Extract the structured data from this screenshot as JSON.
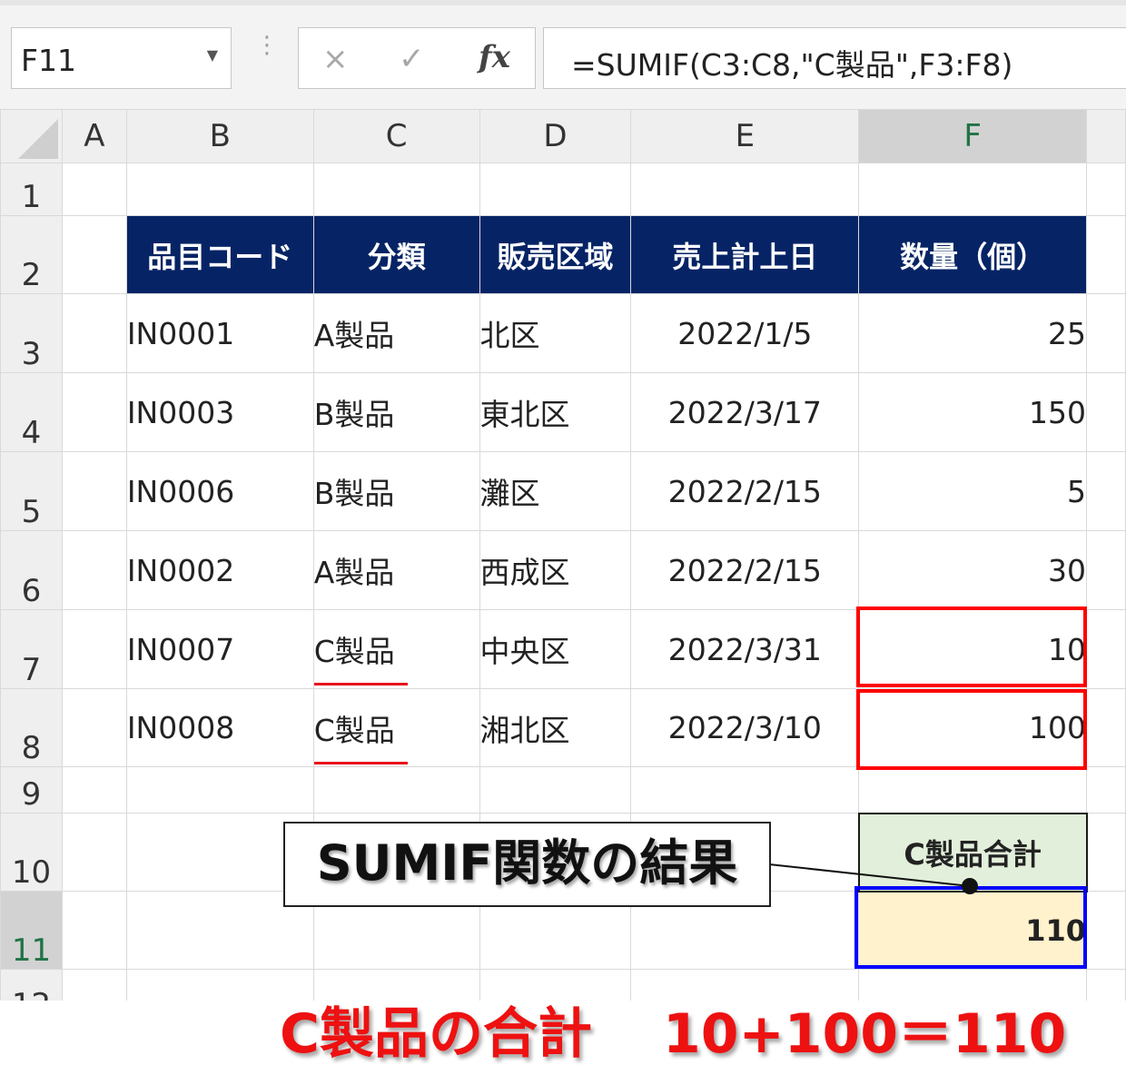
{
  "formula_bar": {
    "name_box": "F11",
    "cancel_icon": "×",
    "enter_icon": "✓",
    "fx_label": "fx",
    "formula": "=SUMIF(C3:C8,\"C製品\",F3:F8)"
  },
  "columns": [
    "A",
    "B",
    "C",
    "D",
    "E",
    "F"
  ],
  "rows": [
    "1",
    "2",
    "3",
    "4",
    "5",
    "6",
    "7",
    "8",
    "9",
    "10",
    "11",
    "12"
  ],
  "selected_cell": "F11",
  "table": {
    "headers": [
      "品目コード",
      "分類",
      "販売区域",
      "売上計上日",
      "数量（個）"
    ],
    "rows": [
      [
        "IN0001",
        "A製品",
        "北区",
        "2022/1/5",
        "25"
      ],
      [
        "IN0003",
        "B製品",
        "東北区",
        "2022/3/17",
        "150"
      ],
      [
        "IN0006",
        "B製品",
        "灘区",
        "2022/2/15",
        "5"
      ],
      [
        "IN0002",
        "A製品",
        "西成区",
        "2022/2/15",
        "30"
      ],
      [
        "IN0007",
        "C製品",
        "中央区",
        "2022/3/31",
        "10"
      ],
      [
        "IN0008",
        "C製品",
        "湘北区",
        "2022/3/10",
        "100"
      ]
    ]
  },
  "summary": {
    "label": "C製品合計",
    "value": "110"
  },
  "callout": "SUMIF関数の結果",
  "caption": {
    "left": "C製品の合計",
    "right": "10+100＝110"
  },
  "colors": {
    "header_bg": "#062465",
    "highlight_red": "#ff0000",
    "highlight_blue": "#0000ff",
    "summary_label_bg": "#e2efda",
    "summary_value_bg": "#fff2cc",
    "caption_color": "#ee1111"
  }
}
